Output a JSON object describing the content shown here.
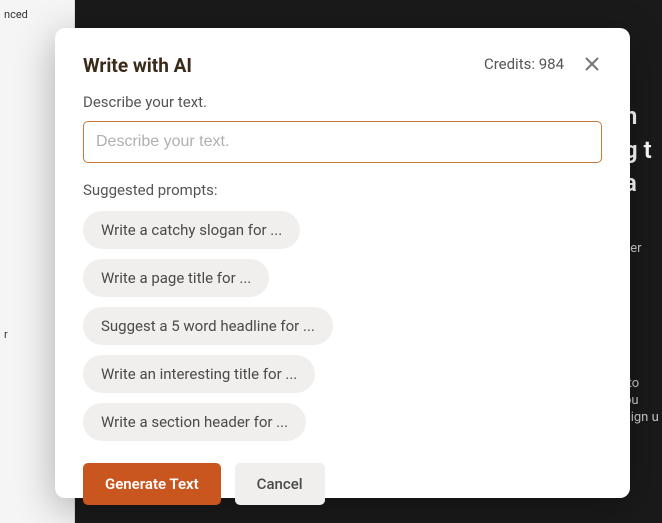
{
  "background": {
    "left_text_top": "nced",
    "left_text_mid": "r",
    "right_text_lines": [
      "n",
      "g t",
      "a"
    ],
    "right_small_top": "ver",
    "right_small_bottom_1": "-to",
    "right_small_bottom_2": "ou",
    "right_small_bottom_3": "sign u"
  },
  "modal": {
    "title": "Write with AI",
    "credits_label": "Credits: 984",
    "describe_label": "Describe your text.",
    "input_placeholder": "Describe your text.",
    "suggested_label": "Suggested prompts:",
    "prompts": [
      "Write a catchy slogan for ...",
      "Write a page title for ...",
      "Suggest a 5 word headline for ...",
      "Write an interesting title for ...",
      "Write a section header for ..."
    ],
    "generate_button": "Generate Text",
    "cancel_button": "Cancel"
  }
}
